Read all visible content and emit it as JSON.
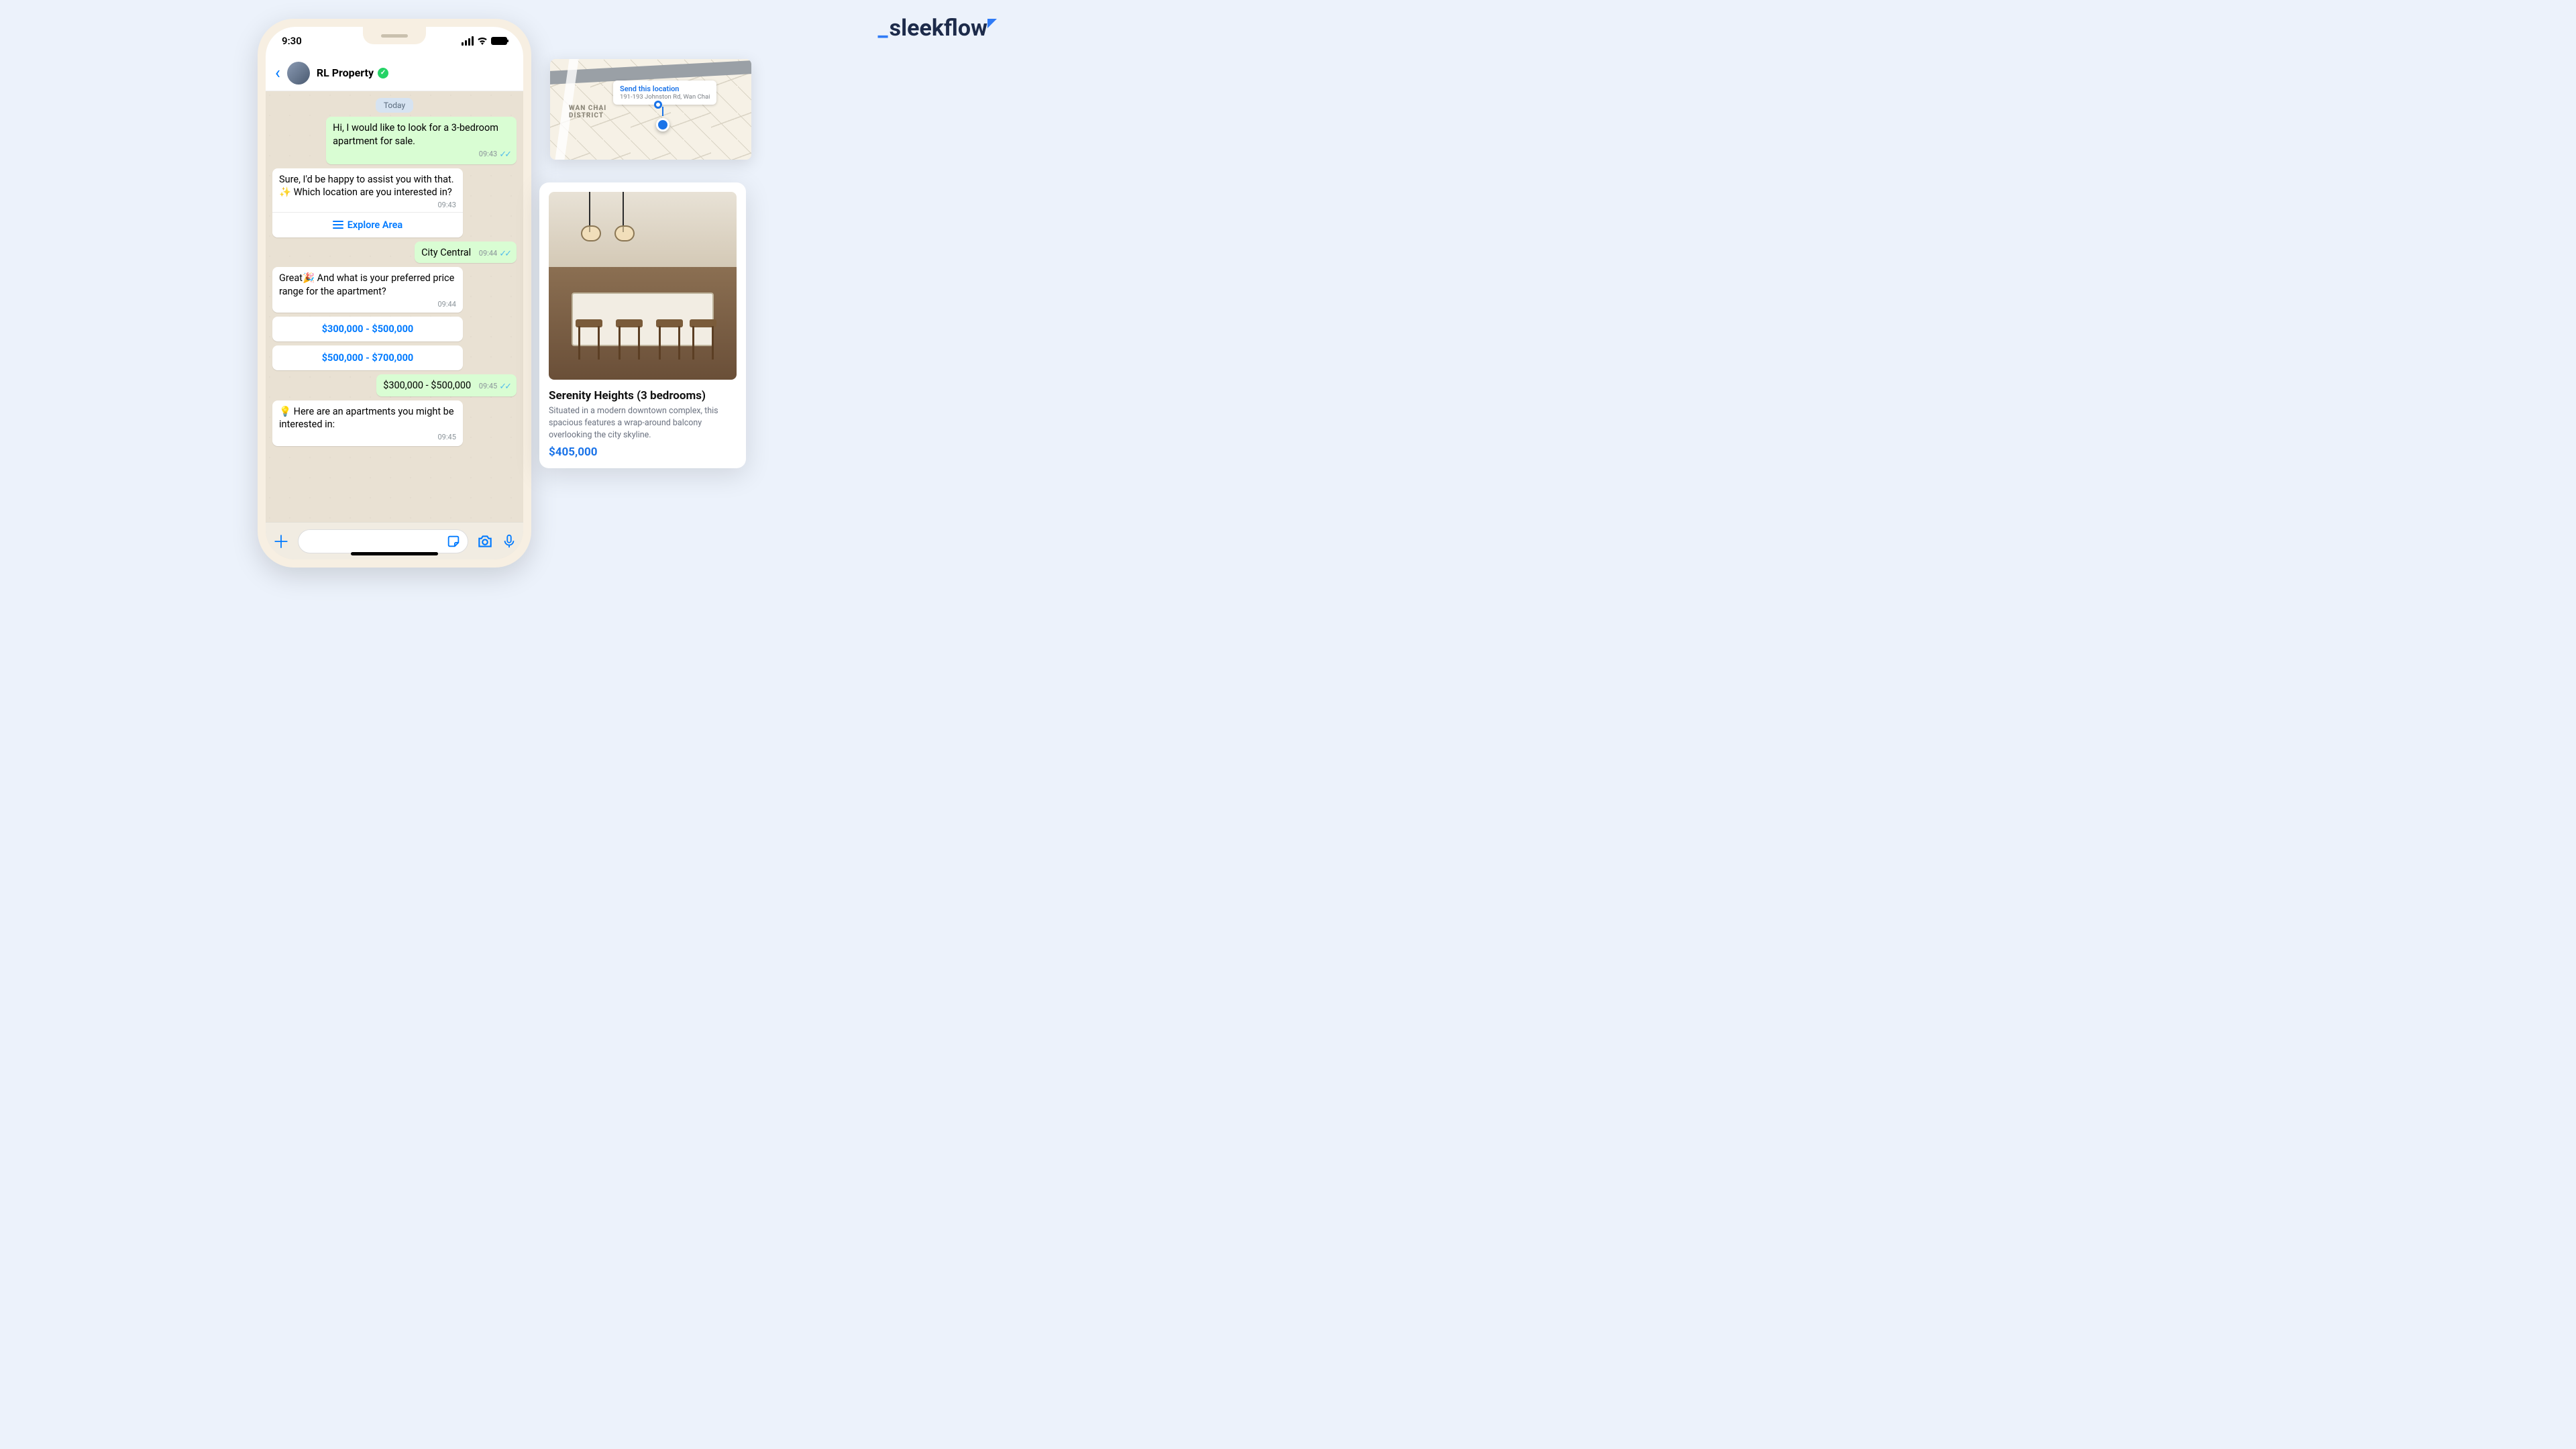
{
  "brand": {
    "name": "sleekflow"
  },
  "statusbar": {
    "time": "9:30"
  },
  "chat": {
    "contact": "RL Property",
    "date_divider": "Today",
    "explore_action": "Explore Area",
    "messages": {
      "m1": {
        "text": "Hi, I would like to look for a 3-bedroom apartment for sale.",
        "time": "09:43"
      },
      "m2": {
        "text": "Sure, I'd be happy to assist you with that. ✨ Which location are you interested in?",
        "time": "09:43"
      },
      "m3": {
        "text": "City Central",
        "time": "09:44"
      },
      "m4": {
        "text": "Great🎉 And what is your preferred price range for the apartment?",
        "time": "09:44"
      },
      "opt1": "$300,000 - $500,000",
      "opt2": "$500,000 - $700,000",
      "m5": {
        "text": "$300,000 - $500,000",
        "time": "09:45"
      },
      "m6": {
        "text": "💡 Here are an apartments you might be interested in:",
        "time": "09:45"
      }
    }
  },
  "map": {
    "action": "Send this location",
    "address": "191-193 Johnston Rd, Wan Chai",
    "district_line1": "WAN CHAI",
    "district_line2": "DISTRICT"
  },
  "listing": {
    "title": "Serenity Heights (3 bedrooms)",
    "description": "Situated in a modern downtown complex, this spacious features a wrap-around balcony overlooking the city skyline.",
    "price": "$405,000"
  }
}
